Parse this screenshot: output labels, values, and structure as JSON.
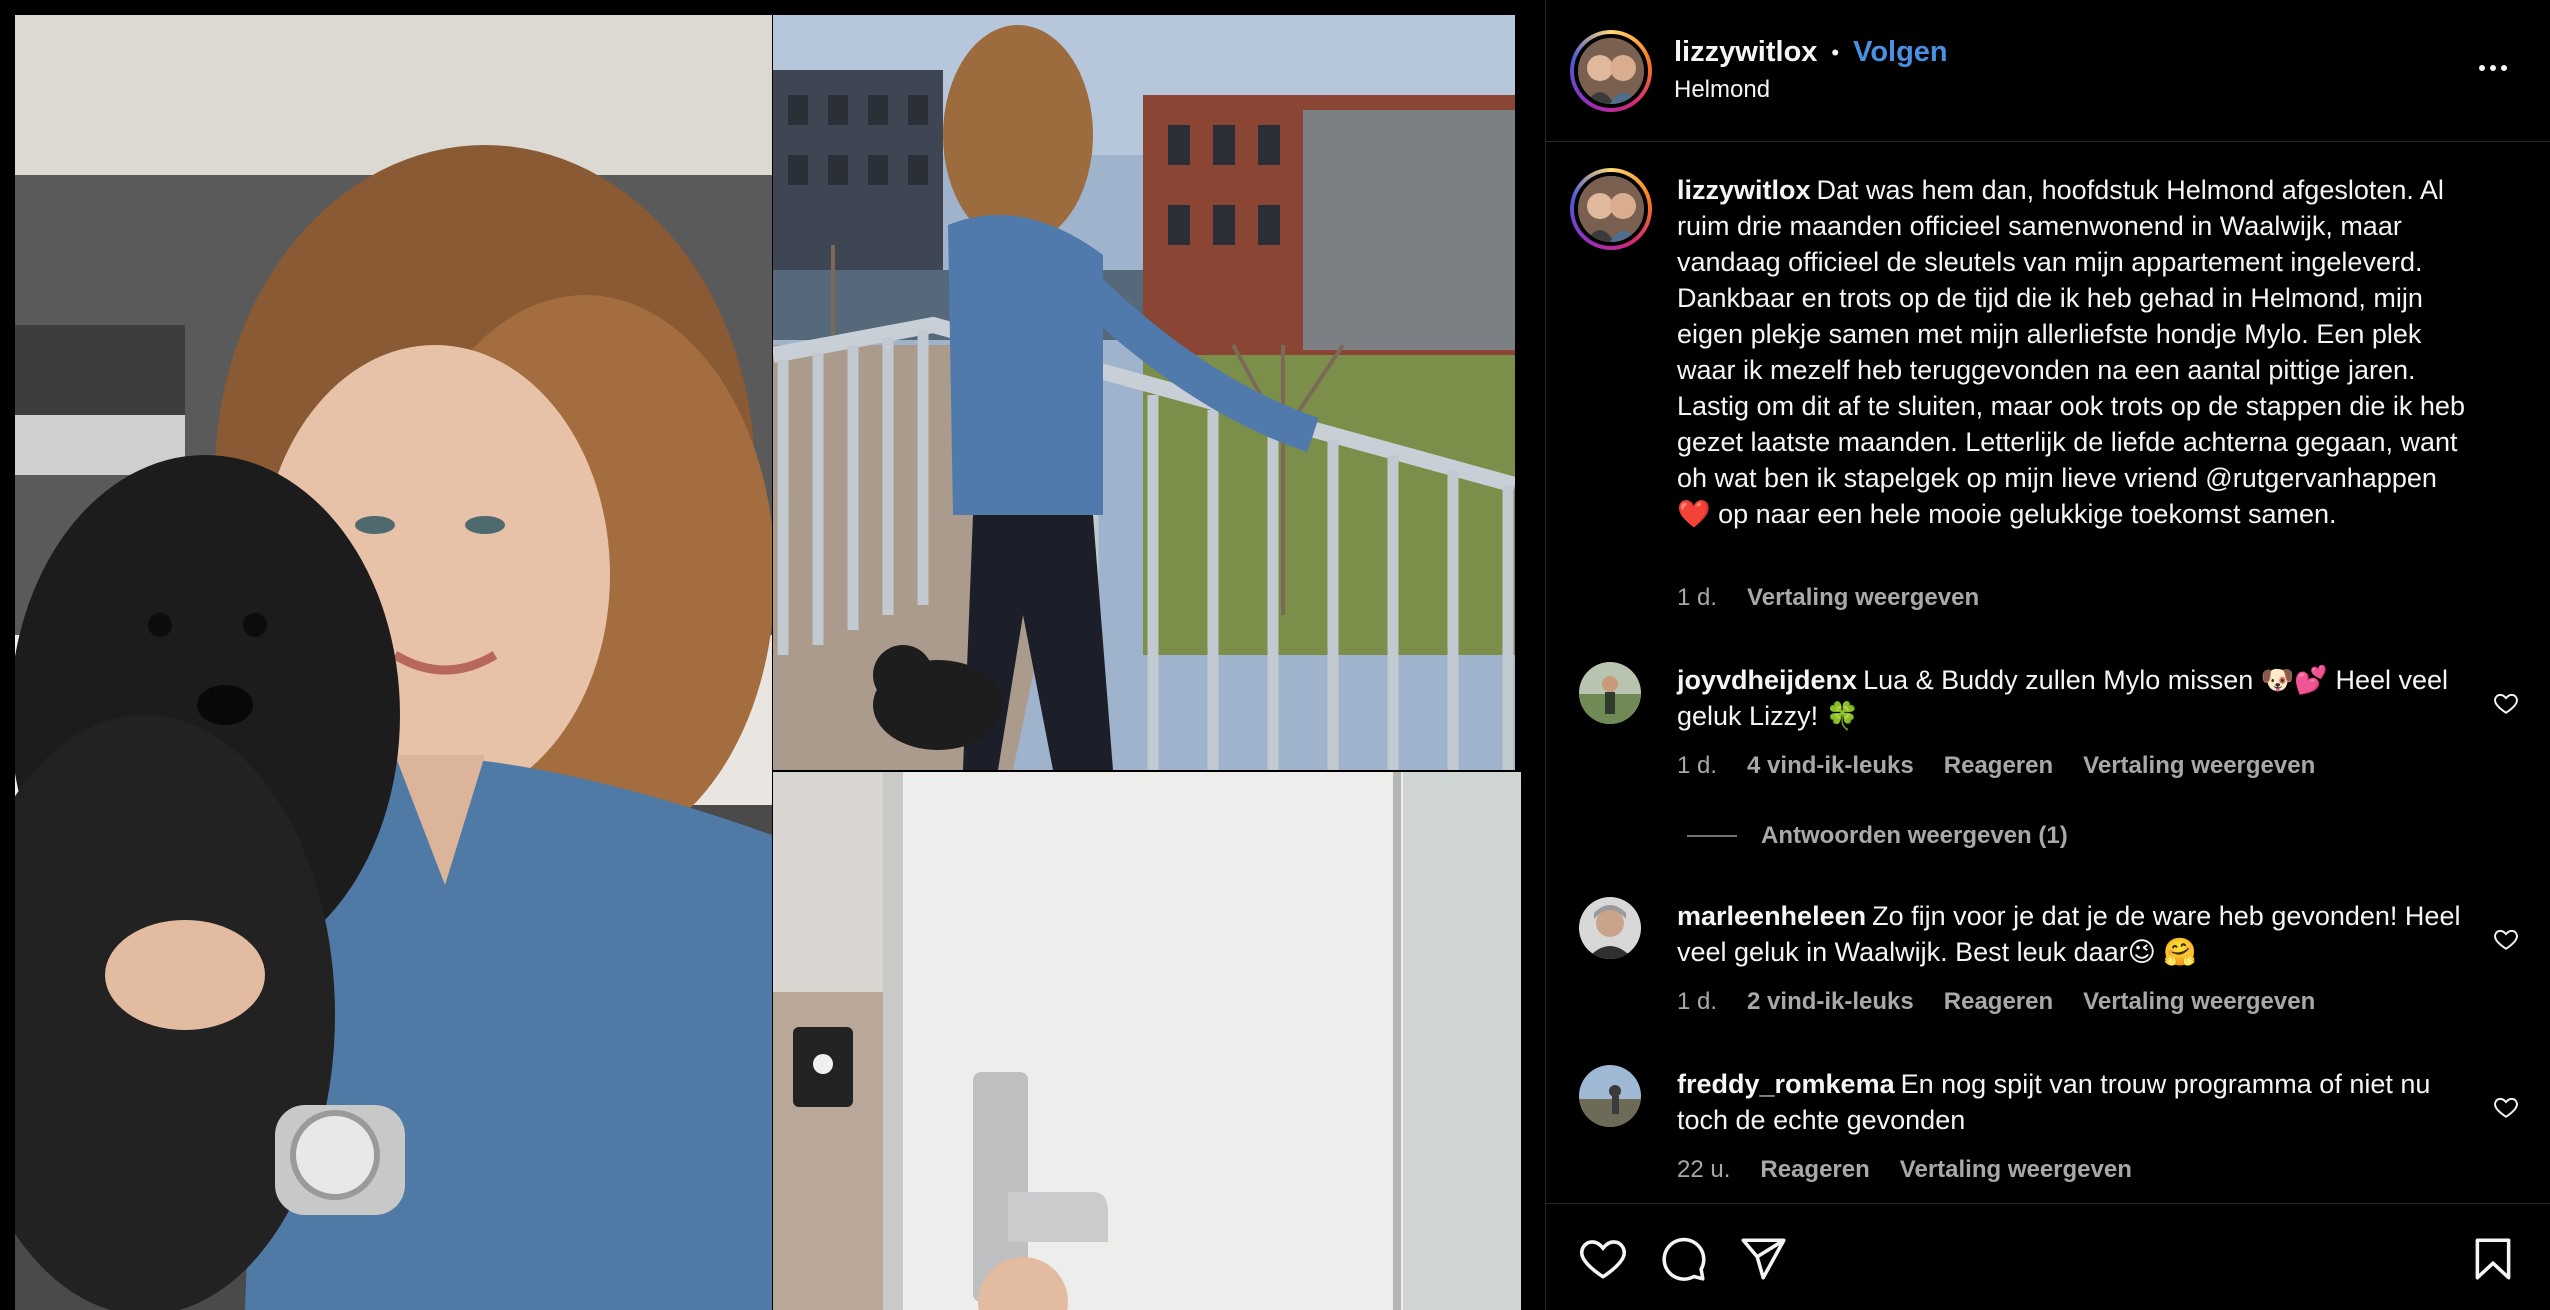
{
  "post": {
    "author": "lizzywitlox",
    "separator": "•",
    "follow_label": "Volgen",
    "location": "Helmond",
    "more_icon": "more-horizontal-icon"
  },
  "caption": {
    "username": "lizzywitlox",
    "text": "Dat was hem dan, hoofdstuk Helmond afgesloten. Al ruim drie maanden officieel samenwonend in Waalwijk, maar vandaag officieel de sleutels van mijn appartement ingeleverd. Dankbaar en trots op de tijd die ik heb gehad in Helmond, mijn eigen plekje samen met mijn allerliefste hondje Mylo. Een plek waar ik mezelf heb teruggevonden na een aantal pittige jaren. Lastig om dit af te sluiten, maar ook trots op de stappen die ik heb gezet laatste maanden. Letterlijk de liefde achterna gegaan, want oh wat ben ik stapelgek op mijn lieve vriend @rutgervanhappen ❤️ op naar een hele mooie gelukkige toekomst samen.",
    "time": "1 d.",
    "translate_label": "Vertaling weergeven"
  },
  "comments": [
    {
      "username": "joyvdheijdenx",
      "text": "Lua & Buddy zullen Mylo missen 🐶💕 Heel veel geluk Lizzy! 🍀",
      "time": "1 d.",
      "likes": "4 vind-ik-leuks",
      "reply_label": "Reageren",
      "translate_label": "Vertaling weergeven",
      "view_replies": "Antwoorden weergeven (1)"
    },
    {
      "username": "marleenheleen",
      "text": "Zo fijn voor je dat je de ware heb gevonden! Heel veel geluk in Waalwijk. Best leuk daar😉 🤗",
      "time": "1 d.",
      "likes": "2 vind-ik-leuks",
      "reply_label": "Reageren",
      "translate_label": "Vertaling weergeven"
    },
    {
      "username": "freddy_romkema",
      "text": "En nog spijt van trouw programma of niet nu toch de echte gevonden",
      "time": "22 u.",
      "reply_label": "Reageren",
      "translate_label": "Vertaling weergeven"
    }
  ],
  "icons": {
    "like": "heart-icon",
    "comment": "comment-icon",
    "share": "send-icon",
    "save": "bookmark-icon"
  },
  "colors": {
    "background": "#000000",
    "text": "#f5f5f5",
    "muted": "#a8a8a8",
    "follow": "#4a90e2",
    "divider": "#262626"
  }
}
